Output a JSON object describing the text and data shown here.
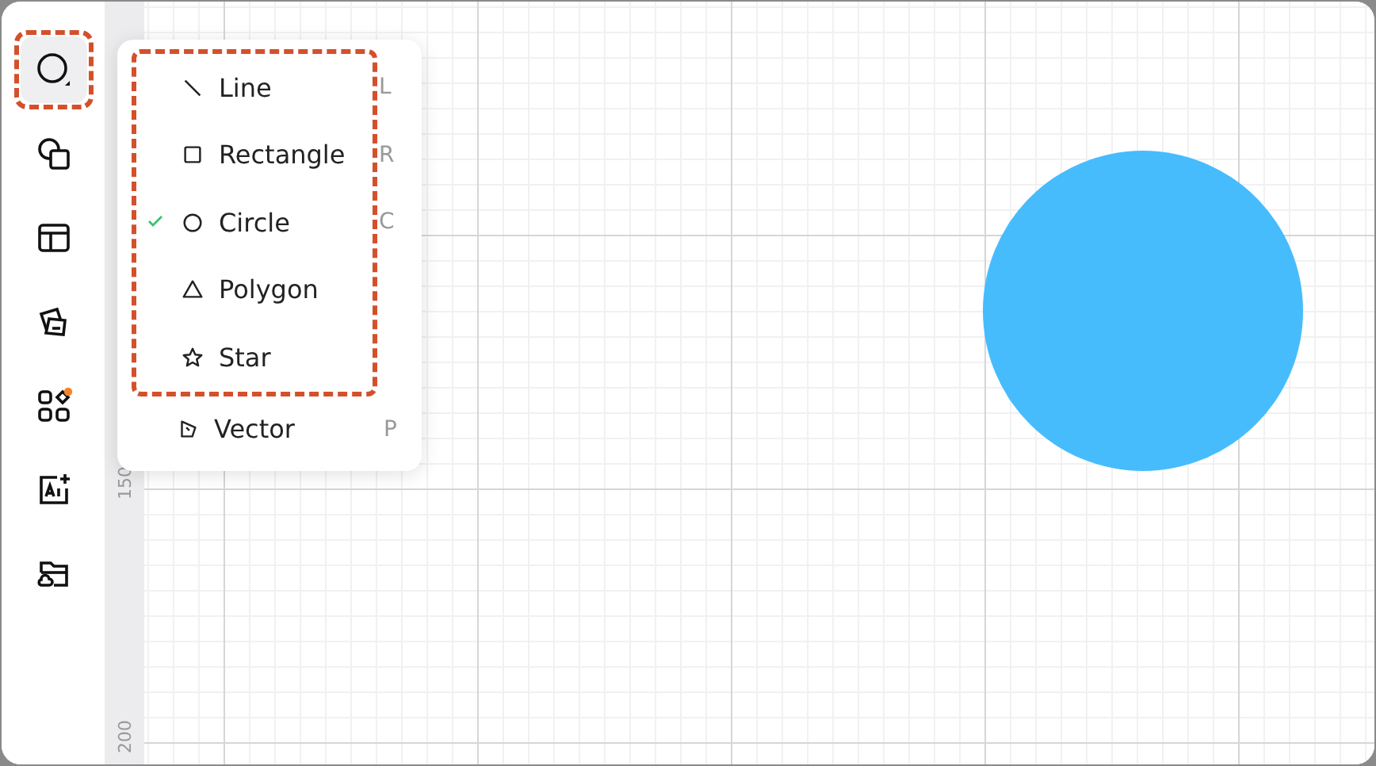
{
  "toolbar": {
    "tools": [
      {
        "kind": "circle",
        "selected": true
      },
      {
        "kind": "shapes",
        "selected": false
      },
      {
        "kind": "layout",
        "selected": false
      },
      {
        "kind": "cards",
        "selected": false
      },
      {
        "kind": "apps",
        "selected": false
      },
      {
        "kind": "ai",
        "selected": false
      },
      {
        "kind": "folder",
        "selected": false
      }
    ]
  },
  "ruler": {
    "labels": [
      "150",
      "200"
    ]
  },
  "menu": {
    "highlighted_items": [
      {
        "kind": "line",
        "label": "Line",
        "shortcut": "L",
        "checked": false
      },
      {
        "kind": "rectangle",
        "label": "Rectangle",
        "shortcut": "R",
        "checked": false
      },
      {
        "kind": "circle",
        "label": "Circle",
        "shortcut": "C",
        "checked": true
      },
      {
        "kind": "polygon",
        "label": "Polygon",
        "checked": false
      },
      {
        "kind": "star",
        "label": "Star",
        "checked": false
      }
    ],
    "items": [
      {
        "kind": "vector",
        "label": "Vector",
        "shortcut": "P",
        "checked": false
      }
    ]
  },
  "canvas": {
    "shapes": [
      {
        "kind": "circle",
        "color": "#47bcfd"
      }
    ]
  }
}
